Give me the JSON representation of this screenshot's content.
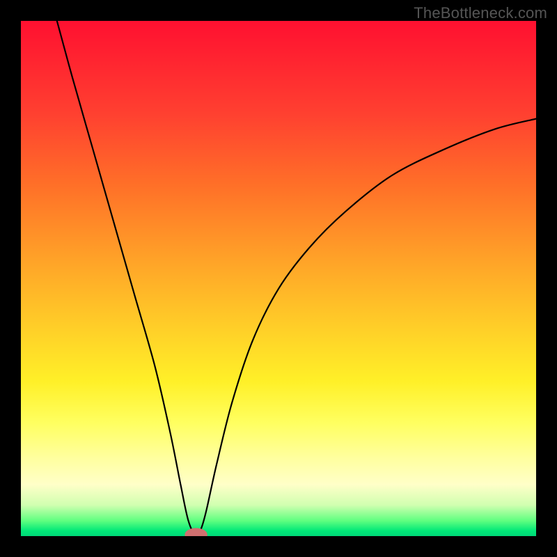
{
  "watermark": "TheBottleneck.com",
  "chart_data": {
    "type": "line",
    "title": "",
    "xlabel": "",
    "ylabel": "",
    "xlim": [
      0,
      100
    ],
    "ylim": [
      0,
      100
    ],
    "gradient_stops": [
      {
        "pos": 0,
        "color": "#ff1030"
      },
      {
        "pos": 18,
        "color": "#ff4030"
      },
      {
        "pos": 48,
        "color": "#ffa828"
      },
      {
        "pos": 70,
        "color": "#fff028"
      },
      {
        "pos": 85,
        "color": "#ffffa0"
      },
      {
        "pos": 97,
        "color": "#60ff80"
      },
      {
        "pos": 100,
        "color": "#00d878"
      }
    ],
    "series": [
      {
        "name": "bottleneck-curve",
        "x": [
          7,
          10,
          14,
          18,
          22,
          26,
          29,
          31,
          32.5,
          34,
          35,
          36,
          38,
          41,
          45,
          50,
          56,
          63,
          72,
          82,
          92,
          100
        ],
        "y": [
          100,
          89,
          75,
          61,
          47,
          33,
          20,
          10,
          3,
          0,
          1.5,
          5,
          14,
          26,
          38,
          48,
          56,
          63,
          70,
          75,
          79,
          81
        ]
      }
    ],
    "minimum_marker": {
      "x": 34,
      "y": 0,
      "rx": 2.2,
      "ry": 1.3,
      "color": "#d07070"
    }
  }
}
